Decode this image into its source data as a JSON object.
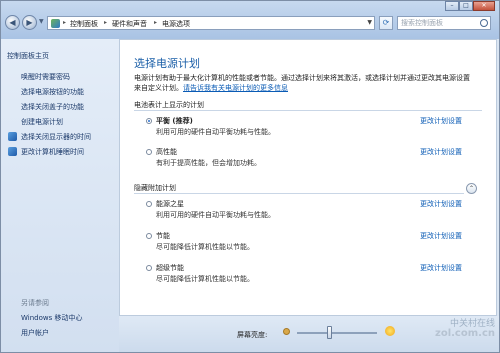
{
  "address": {
    "crumbs": [
      "控制面板",
      "硬件和声音",
      "电源选项"
    ],
    "search_placeholder": "搜索控制面板"
  },
  "window_controls": {
    "minimize": "–",
    "maximize": "□",
    "close": "✕"
  },
  "sidebar": {
    "home": "控制面板主页",
    "items": [
      "唤醒时需要密码",
      "选择电源按钮的功能",
      "选择关闭盖子的功能",
      "创建电源计划",
      "选择关闭显示器的时间",
      "更改计算机睡眠时间"
    ],
    "see_also_title": "另请参阅",
    "see_also": [
      "Windows 移动中心",
      "用户帐户"
    ]
  },
  "main": {
    "title": "选择电源计划",
    "description_line1": "电源计划有助于最大化计算机的性能或者节能。通过选择计划来将其激活，或选择计划并通过更改其电源设置",
    "description_line2_prefix": "来自定义计划。",
    "description_link": "请告诉我有关电源计划的更多信息",
    "battery_section": "电池表计上显示的计划",
    "hidden_section": "隐藏附加计划",
    "change_link": "更改计划设置",
    "plans_shown": [
      {
        "name": "平衡 (推荐)",
        "desc": "利用可用的硬件自动平衡功耗与性能。",
        "selected": true
      },
      {
        "name": "高性能",
        "desc": "有利于提高性能，但会增加功耗。",
        "selected": false
      }
    ],
    "plans_hidden": [
      {
        "name": "能源之星",
        "desc": "利用可用的硬件自动平衡功耗与性能。",
        "selected": false
      },
      {
        "name": "节能",
        "desc": "尽可能降低计算机性能以节能。",
        "selected": false
      },
      {
        "name": "超级节能",
        "desc": "尽可能降低计算机性能以节能。",
        "selected": false
      }
    ]
  },
  "bottom": {
    "brightness_label": "屏幕亮度:",
    "brightness_level": 0.4
  },
  "watermark": {
    "line1": "中关村在线",
    "line2": "zol.com.cn"
  }
}
